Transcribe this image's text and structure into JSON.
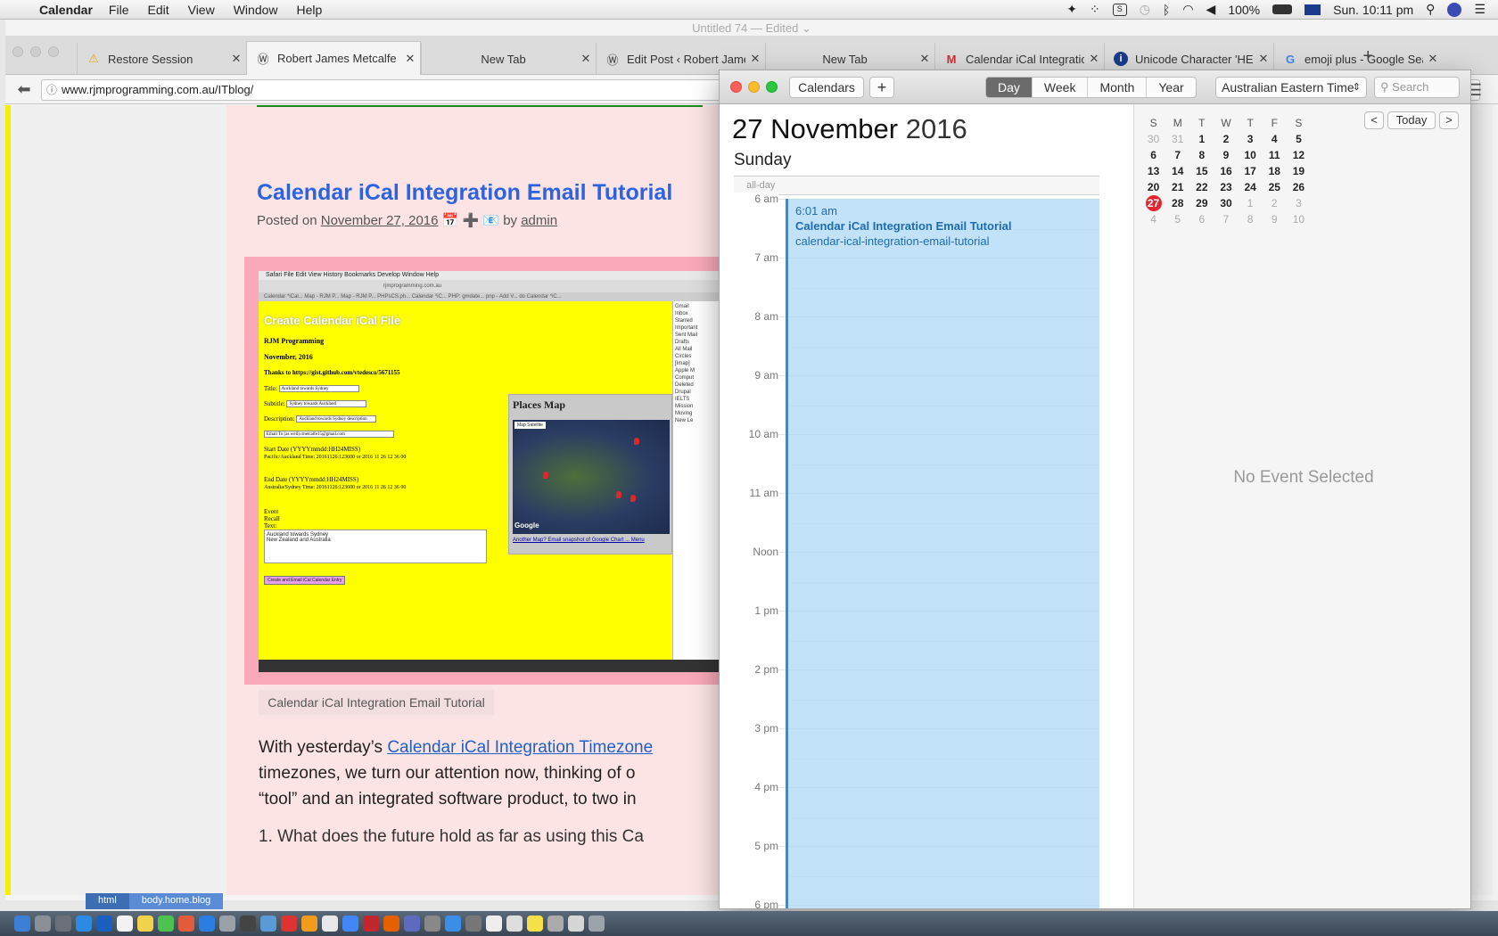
{
  "menubar": {
    "app_name": "Calendar",
    "menus": [
      "File",
      "Edit",
      "View",
      "Window",
      "Help"
    ],
    "battery": "100%",
    "clock": "Sun. 10:11 pm"
  },
  "browser": {
    "ghost_title": "Untitled 74 — Edited ⌄",
    "tabs": [
      {
        "label": "Restore Session",
        "icon": "warning-icon"
      },
      {
        "label": "Robert James Metcalfe ...",
        "icon": "wordpress-icon"
      },
      {
        "label": "New Tab",
        "icon": ""
      },
      {
        "label": "Edit Post ‹ Robert Jame...",
        "icon": "wordpress-icon"
      },
      {
        "label": "New Tab",
        "icon": ""
      },
      {
        "label": "Calendar iCal Integratio...",
        "icon": "gmail-icon"
      },
      {
        "label": "Unicode Character 'HE...",
        "icon": "info-icon"
      },
      {
        "label": "emoji plus - Google Sea...",
        "icon": "google-icon"
      }
    ],
    "url": "www.rjmprogramming.com.au/ITblog/"
  },
  "page": {
    "post_title": "Calendar iCal Integration Email Tutorial",
    "posted_on_label": "Posted on",
    "posted_date": "November 27, 2016",
    "meta_glyphs": "📅 ➕ 📧",
    "by_label": "by",
    "author": "admin",
    "caption": "Calendar iCal Integration Email Tutorial",
    "body_prefix": "With yesterday’s",
    "body_link": "Calendar iCal Integration Timezone",
    "body_line2": "timezones, we turn our attention now, thinking of o",
    "body_line3": "“tool” and an integrated software product, to two in",
    "list_item": "1.  What does the future hold as far as using this Ca",
    "statusbar": [
      "html",
      "body.home.blog"
    ],
    "shot": {
      "menu": " Safari   File   Edit   View   History   Bookmarks   Develop   Window   Help",
      "address": "rjmprogramming.com.au",
      "tabs": "Calendar *iCal...     Map - RJM P...     Map - RJM P...     PHPsCS.ph...     Calendar *iC...     PHP: gmdate...     pnp - Add V...     do     Calendar *iC...",
      "title": "Create Calendar iCal File",
      "org": "RJM Programming",
      "month": "November, 2016",
      "thanks": "Thanks to https://gist.github.com/vtedesco/5671155",
      "title_label": "Title:",
      "title_value": "Auckland towards Sydney",
      "subtitle_label": "Subtitle:",
      "subtitle_value": "Sydney towards Auckland",
      "desc_label": "Description:",
      "desc_value": "Auckland towards Sydney description",
      "email_value": "Email To (as well)    rmetcalfe15@gmail.com",
      "start_label": "Start Date (YYYYmmdd:HH24MISS)",
      "start_row": "Pacific/Auckland   Time: 20161126:123600  or  2016  11  26  12  36  00",
      "end_label": "End Date (YYYYmmdd:HH24MISS)",
      "end_row": "Australia/Sydney   Time: 20161126:123600  or  2016  11  26  12  36  00",
      "event_label": "Event",
      "recall_label": "Recall",
      "text_label": "Text:",
      "textarea": "Auckland towards Sydney\nNew Zealand and Australia",
      "button": "Create and Email iCal Calendar Entry",
      "map_title": "Places Map",
      "map_tabs": "Map   Satellite",
      "map_brand": "Google",
      "map_links": "Another Map?   Email snapshot of Google Chart ...   Menu",
      "side_text": "Gmail\nInbox\nStarred\nImportant\nSent Mail\nDrafts\nAll Mail\nCircles\n[Imap]\nApple M\nComput\nDeleted\nDrupal\nIELTS\nMission\nMoving\nNew Le"
    }
  },
  "calendar": {
    "calendars_button": "Calendars",
    "add_button": "+",
    "views": [
      "Day",
      "Week",
      "Month",
      "Year"
    ],
    "active_view": "Day",
    "timezone": "Australian Eastern Time",
    "search_placeholder": "Search",
    "date_day_month": "27 November",
    "date_year": "2016",
    "weekday": "Sunday",
    "allday_label": "all-day",
    "hours": [
      "6 am",
      "7 am",
      "8 am",
      "9 am",
      "10 am",
      "11 am",
      "Noon",
      "1 pm",
      "2 pm",
      "3 pm",
      "4 pm",
      "5 pm",
      "6 pm"
    ],
    "event": {
      "time": "6:01 am",
      "title": "Calendar iCal Integration Email Tutorial",
      "location": "calendar-ical-integration-email-tutorial"
    },
    "mini": {
      "weekdays": [
        "S",
        "M",
        "T",
        "W",
        "T",
        "F",
        "S"
      ],
      "weeks": [
        [
          "30",
          "31",
          "1",
          "2",
          "3",
          "4",
          "5"
        ],
        [
          "6",
          "7",
          "8",
          "9",
          "10",
          "11",
          "12"
        ],
        [
          "13",
          "14",
          "15",
          "16",
          "17",
          "18",
          "19"
        ],
        [
          "20",
          "21",
          "22",
          "23",
          "24",
          "25",
          "26"
        ],
        [
          "27",
          "28",
          "29",
          "30",
          "1",
          "2",
          "3"
        ],
        [
          "4",
          "5",
          "6",
          "7",
          "8",
          "9",
          "10"
        ]
      ],
      "today_button": "Today",
      "prev": "<",
      "next": ">"
    },
    "no_event": "No Event Selected"
  },
  "colors": {
    "accent_blue": "#2b63e0",
    "event_fill": "#a7d6f6",
    "today_red": "#e2262f",
    "yellow": "#ffff00"
  }
}
